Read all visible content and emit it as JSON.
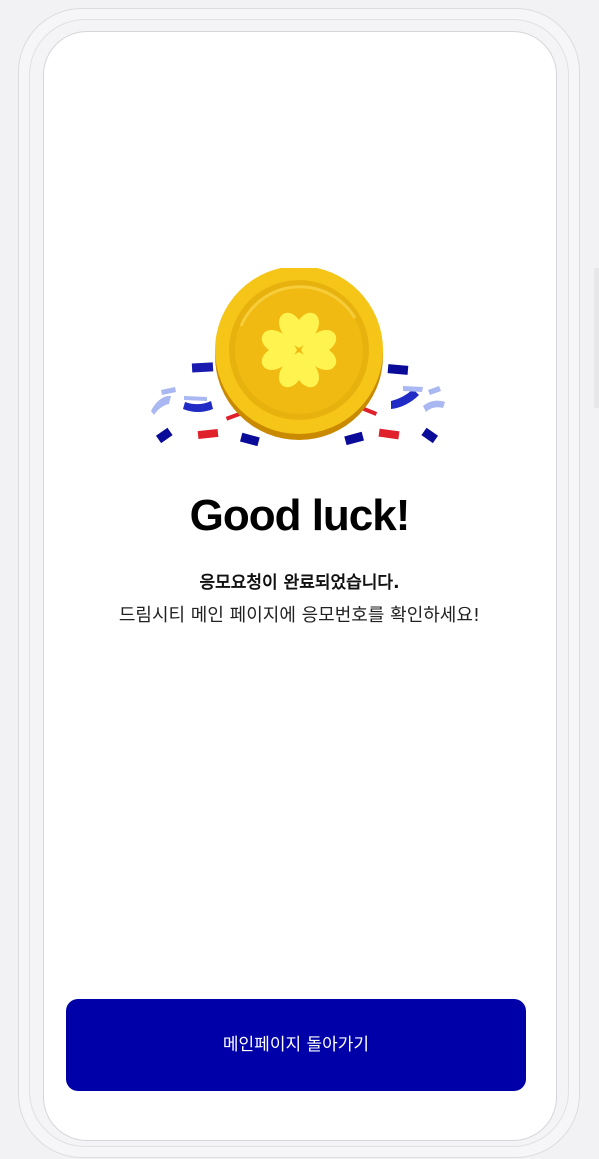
{
  "headline": "Good luck!",
  "message": {
    "title": "응모요청이 완료되었습니다.",
    "subtitle": "드림시티 메인 페이지에 응모번호를 확인하세요!"
  },
  "cta": {
    "label": "메인페이지 돌아가기"
  },
  "illustration": {
    "icon": "gold-coin-clover-icon",
    "confetti_icon": "confetti-icon"
  },
  "colors": {
    "primary": "#0000a8",
    "coin_gold": "#f5c518",
    "coin_dark": "#c98a00",
    "confetti_blue": "#1a1ab0",
    "confetti_light": "#9aa6f0",
    "confetti_red": "#e0202a"
  }
}
